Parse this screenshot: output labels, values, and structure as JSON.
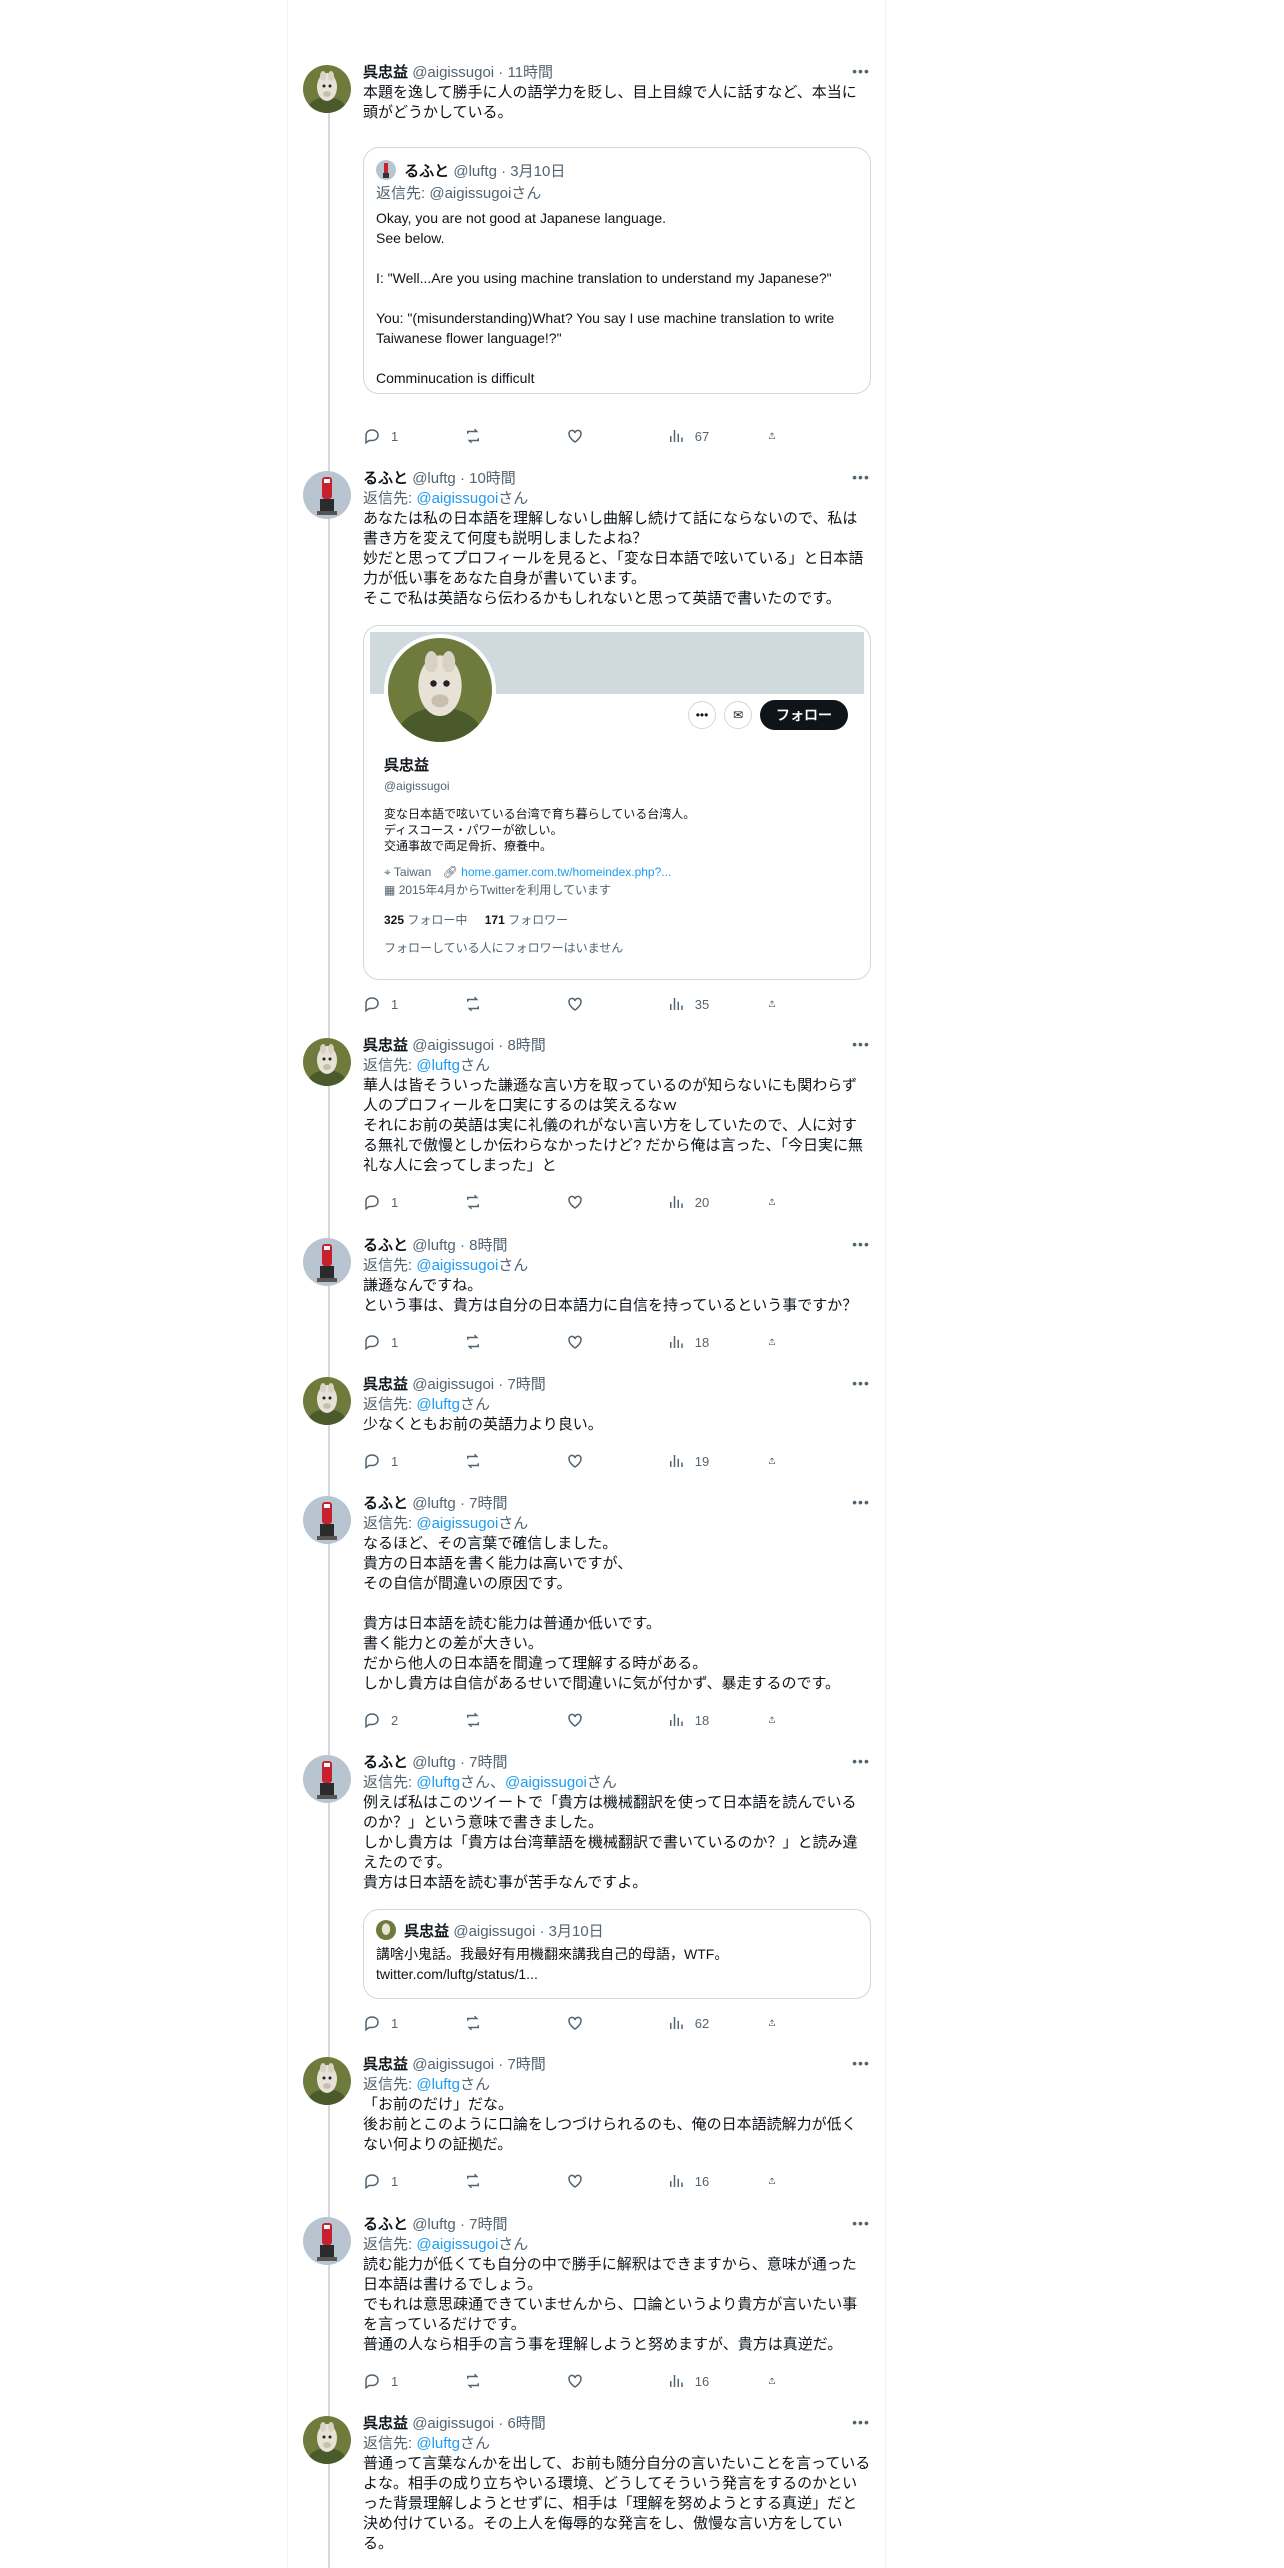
{
  "tweets": [
    {
      "author": "呉忠益",
      "handle": "@aigissugoi",
      "time": "11時間",
      "text": "本題を逸して勝手に人の語学力を貶し、目上目線で人に話すなど、本当に頭がどうかしている。",
      "quote": {
        "author": "るふと",
        "handle": "@luftg",
        "time": "3月10日",
        "reply_prefix": "返信先: ",
        "reply_to": "@aigissugoi",
        "reply_suffix": "さん",
        "text": "Okay, you are not good at Japanese language.\nSee below.\n\nI: \"Well...Are you using machine translation to understand my Japanese?\"\n\nYou: \"(misunderstanding)What? You say I use machine translation to write Taiwanese flower language!?\"\n\nComminucation is difficult"
      },
      "replies": "1",
      "views": "67"
    },
    {
      "author": "るふと",
      "handle": "@luftg",
      "time": "10時間",
      "reply_prefix": "返信先: ",
      "reply_to": "@aigissugoi",
      "reply_suffix": "さん",
      "text": "あなたは私の日本語を理解しないし曲解し続けて話にならないので、私は書き方を変えて何度も説明しましたよね？\n妙だと思ってプロフィールを見ると、「変な日本語で呟いている」と日本語力が低い事をあなた自身が書いています。\nそこで私は英語なら伝わるかもしれないと思って英語で書いたのです。",
      "profile_card": {
        "name": "呉忠益",
        "handle": "@aigissugoi",
        "follow_label": "フォロー",
        "bio": "変な日本語で呟いている台湾で育ち暮らしている台湾人。\nディスコース・パワーが欲しい。\n交通事故で両足骨折、療養中。",
        "location": "Taiwan",
        "link": "home.gamer.com.tw/homeindex.php?...",
        "joined": "2015年4月からTwitterを利用しています",
        "following_count": "325",
        "following_label": "フォロー中",
        "followers_count": "171",
        "followers_label": "フォロワー",
        "mutual_note": "フォローしている人にフォロワーはいません"
      },
      "replies": "1",
      "views": "35"
    },
    {
      "author": "呉忠益",
      "handle": "@aigissugoi",
      "time": "8時間",
      "reply_prefix": "返信先: ",
      "reply_to": "@luftg",
      "reply_suffix": "さん",
      "text": "華人は皆そういった謙遜な言い方を取っているのが知らないにも関わらず人のプロフィールを口実にするのは笑えるなｗ\nそれにお前の英語は実に礼儀のれがない言い方をしていたので、人に対する無礼で傲慢としか伝わらなかったけど? だから俺は言った、「今日実に無礼な人に会ってしまった」と",
      "replies": "1",
      "views": "20"
    },
    {
      "author": "るふと",
      "handle": "@luftg",
      "time": "8時間",
      "reply_prefix": "返信先: ",
      "reply_to": "@aigissugoi",
      "reply_suffix": "さん",
      "text": "謙遜なんですね。\nという事は、貴方は自分の日本語力に自信を持っているという事ですか？",
      "replies": "1",
      "views": "18"
    },
    {
      "author": "呉忠益",
      "handle": "@aigissugoi",
      "time": "7時間",
      "reply_prefix": "返信先: ",
      "reply_to": "@luftg",
      "reply_suffix": "さん",
      "text": "少なくともお前の英語力より良い。",
      "replies": "1",
      "views": "19"
    },
    {
      "author": "るふと",
      "handle": "@luftg",
      "time": "7時間",
      "reply_prefix": "返信先: ",
      "reply_to": "@aigissugoi",
      "reply_suffix": "さん",
      "text": "なるほど、その言葉で確信しました。\n貴方の日本語を書く能力は高いですが、\nその自信が間違いの原因です。\n\n貴方は日本語を読む能力は普通か低いです。\n書く能力との差が大きい。\nだから他人の日本語を間違って理解する時がある。\nしかし貴方は自信があるせいで間違いに気が付かず、暴走するのです。",
      "replies": "2",
      "views": "18"
    },
    {
      "author": "るふと",
      "handle": "@luftg",
      "time": "7時間",
      "reply_prefix": "返信先: ",
      "reply_to": "@luftg",
      "reply_sep": "さん、",
      "reply_to2": "@aigissugoi",
      "reply_suffix": "さん",
      "text": "例えば私はこのツイートで「貴方は機械翻訳を使って日本語を読んでいるのか？」という意味で書きました。\nしかし貴方は「貴方は台湾華語を機械翻訳で書いているのか？」と読み違えたのです。\n貴方は日本語を読む事が苦手なんですよ。",
      "quote": {
        "author": "呉忠益",
        "handle": "@aigissugoi",
        "time": "3月10日",
        "text": "講啥小鬼話。我最好有用機翻來講我自己的母語，WTF。\ntwitter.com/luftg/status/1..."
      },
      "replies": "1",
      "views": "62"
    },
    {
      "author": "呉忠益",
      "handle": "@aigissugoi",
      "time": "7時間",
      "reply_prefix": "返信先: ",
      "reply_to": "@luftg",
      "reply_suffix": "さん",
      "text": "「お前のだけ」だな。\n後お前とこのように口論をしつづけられるのも、俺の日本語読解力が低くない何よりの証拠だ。",
      "replies": "1",
      "views": "16"
    },
    {
      "author": "るふと",
      "handle": "@luftg",
      "time": "7時間",
      "reply_prefix": "返信先: ",
      "reply_to": "@aigissugoi",
      "reply_suffix": "さん",
      "text": "読む能力が低くても自分の中で勝手に解釈はできますから、意味が通った日本語は書けるでしょう。\nでもれは意思疎通できていませんから、口論というより貴方が言いたい事を言っているだけです。\n普通の人なら相手の言う事を理解しようと努めますが、貴方は真逆だ。",
      "replies": "1",
      "views": "16"
    },
    {
      "author": "呉忠益",
      "handle": "@aigissugoi",
      "time": "6時間",
      "reply_prefix": "返信先: ",
      "reply_to": "@luftg",
      "reply_suffix": "さん",
      "text": "普通って言葉なんかを出して、お前も随分自分の言いたいことを言っているよな。相手の成り立ちやいる環境、どうしてそういう発言をするのかといった背景理解しようとせずに、相手は「理解を努めようとする真逆」だと決め付けている。その上人を侮辱的な発言をし、傲慢な言い方をしている。"
    }
  ],
  "icons": {
    "reply": "reply-icon",
    "retweet": "retweet-icon",
    "like": "heart-icon",
    "views": "views-icon",
    "share": "share-icon",
    "more": "more-icon"
  },
  "colors": {
    "link": "#1d9bf0",
    "secondary": "#536471",
    "border": "#cfd9de"
  },
  "sep": "·"
}
